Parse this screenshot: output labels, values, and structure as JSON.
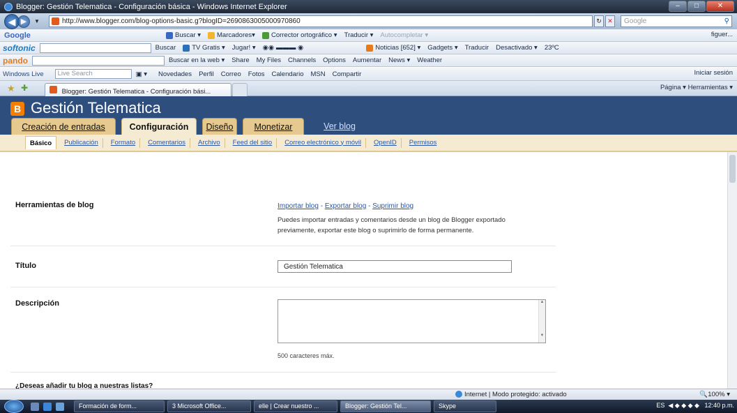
{
  "window": {
    "title": "Blogger: Gestión Telematica - Configuración básica - Windows Internet Explorer"
  },
  "address": {
    "url": "http://www.blogger.com/blog-options-basic.g?blogID=2690863005000970860",
    "search_placeholder": "Google"
  },
  "toolbars": {
    "google": {
      "brand": "Google",
      "items": [
        "Buscar",
        "Marcadores",
        "Corrector ortográfico",
        "Traducir",
        "Autocompletar",
        "figuer..."
      ]
    },
    "softonic": {
      "brand": "softonic",
      "items": [
        "Buscar",
        "TV Gratis",
        "Jugar!",
        "Noticias [652]",
        "Gadgets",
        "Traducir",
        "Desactivado",
        "23ºC"
      ]
    },
    "pando": {
      "brand": "pando",
      "items": [
        "Buscar en la web",
        "Share",
        "My Files",
        "Channels",
        "Options",
        "Aumentar",
        "News",
        "Weather"
      ]
    },
    "windows_live": {
      "brand": "Windows Live",
      "search_placeholder": "Live Search",
      "items": [
        "Novedades",
        "Perfil",
        "Correo",
        "Fotos",
        "Calendario",
        "MSN",
        "Compartir"
      ],
      "signin": "Iniciar sesión"
    }
  },
  "browser_tab": {
    "label": "Blogger: Gestión Telematica - Configuración bási...",
    "commands": "Página ▾   Herramientas ▾"
  },
  "blog": {
    "title": "Gestión Telematica",
    "tabs": [
      {
        "label": "Creación de entradas"
      },
      {
        "label": "Configuración"
      },
      {
        "label": "Diseño"
      },
      {
        "label": "Monetizar"
      },
      {
        "label": "Ver blog"
      }
    ],
    "subtabs": [
      "Básico",
      "Publicación",
      "Formato",
      "Comentarios",
      "Archivo",
      "Feed del sitio",
      "Correo electrónico y móvil",
      "OpenID",
      "Permisos"
    ],
    "sections": {
      "tools": {
        "label": "Herramientas de blog",
        "links": [
          "Importar blog",
          "Exportar blog",
          "Suprimir blog"
        ],
        "description": "Puedes importar entradas y comentarios desde un blog de Blogger exportado previamente, exportar este blog o suprimirlo de forma permanente."
      },
      "title": {
        "label": "Título",
        "value": "Gestión Telematica"
      },
      "description": {
        "label": "Descripción",
        "hint": "500 caracteres máx."
      },
      "next": {
        "label": "¿Deseas añadir tu blog a nuestras listas?"
      }
    }
  },
  "statusbar": {
    "zone": "Internet | Modo protegido: activado",
    "zoom": "100%"
  },
  "taskbar": {
    "tasks": [
      "Formación de form...",
      "3 Microsoft Office...",
      "elle | Crear nuestro ...",
      "Blogger: Gestión Tel...",
      "Skype"
    ],
    "lang": "ES",
    "time": "12:40 p.m."
  }
}
